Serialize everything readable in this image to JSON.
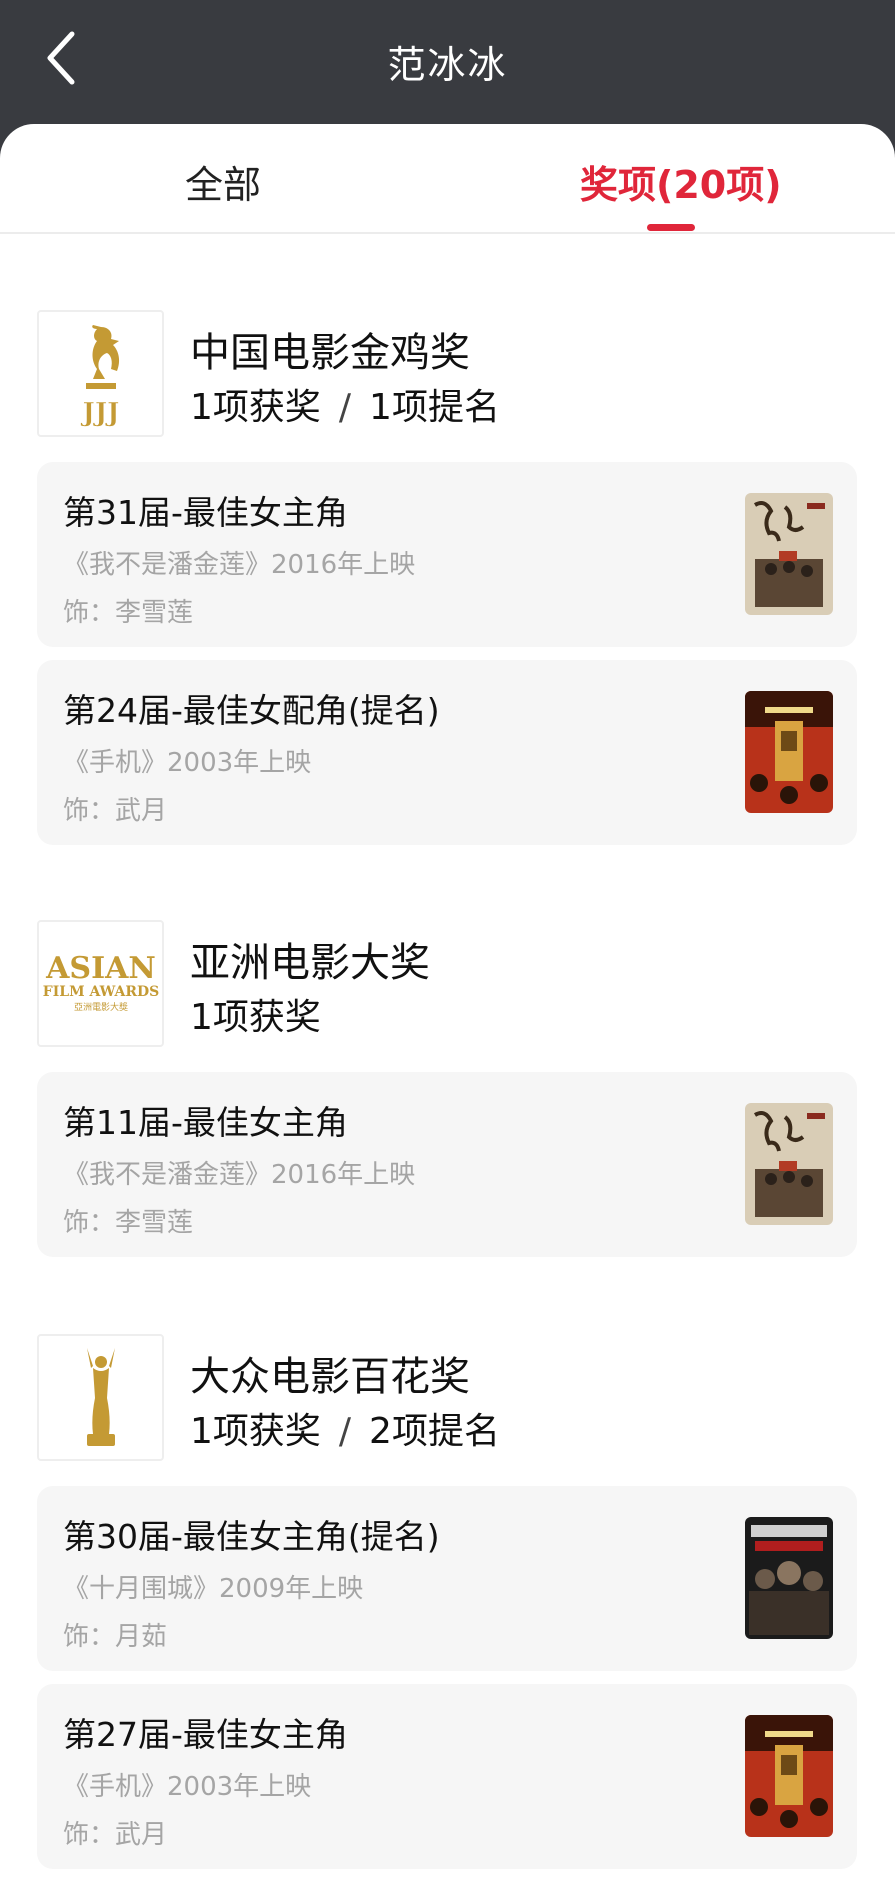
{
  "header": {
    "title": "范冰冰",
    "back_icon": "chevron-left-icon"
  },
  "tabs": [
    {
      "label": "全部",
      "active": false
    },
    {
      "label": "奖项(20项)",
      "active": true
    }
  ],
  "colors": {
    "accent": "#e0263a",
    "header_bg": "#393b40",
    "card_bg": "#f6f6f6",
    "muted_text": "#a5a5a5",
    "logo_gold": "#c49a34"
  },
  "groups": [
    {
      "name": "中国电影金鸡奖",
      "logo_icon": "golden-rooster-logo-icon",
      "wins": "1项获奖",
      "separator": "/",
      "nominations": "1项提名",
      "items": [
        {
          "title": "第31届-最佳女主角",
          "film": "《我不是潘金莲》2016年上映",
          "role": "饰：李雪莲",
          "poster": "i-am-not-madame-bovary-poster"
        },
        {
          "title": "第24届-最佳女配角(提名)",
          "film": "《手机》2003年上映",
          "role": "饰：武月",
          "poster": "cell-phone-poster"
        }
      ]
    },
    {
      "name": "亚洲电影大奖",
      "logo_icon": "asian-film-awards-logo-icon",
      "logo_text": {
        "line1": "ASIAN",
        "line2": "FILM AWARDS",
        "line3": "亞洲電影大獎"
      },
      "wins": "1项获奖",
      "items": [
        {
          "title": "第11届-最佳女主角",
          "film": "《我不是潘金莲》2016年上映",
          "role": "饰：李雪莲",
          "poster": "i-am-not-madame-bovary-poster"
        }
      ]
    },
    {
      "name": "大众电影百花奖",
      "logo_icon": "hundred-flowers-trophy-logo-icon",
      "wins": "1项获奖",
      "separator": "/",
      "nominations": "2项提名",
      "items": [
        {
          "title": "第30届-最佳女主角(提名)",
          "film": "《十月围城》2009年上映",
          "role": "饰：月茹",
          "poster": "bodyguards-and-assassins-poster"
        },
        {
          "title": "第27届-最佳女主角",
          "film": "《手机》2003年上映",
          "role": "饰：武月",
          "poster": "cell-phone-poster"
        }
      ]
    }
  ]
}
